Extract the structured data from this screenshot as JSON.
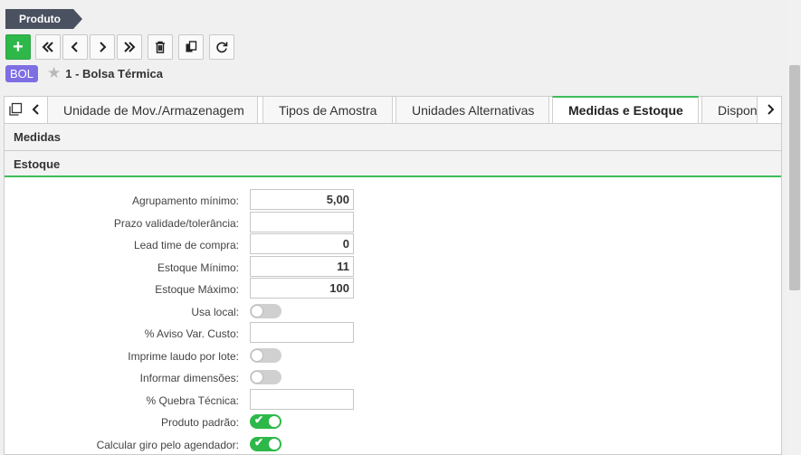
{
  "breadcrumb": {
    "label": "Produto"
  },
  "toolbar": {
    "add_label": "+"
  },
  "record": {
    "badge": "BOL",
    "title": "1 - Bolsa Térmica"
  },
  "tabs": [
    {
      "label": "Unidade de Mov./Armazenagem"
    },
    {
      "label": "Tipos de Amostra"
    },
    {
      "label": "Unidades Alternativas"
    },
    {
      "label": "Medidas e Estoque"
    },
    {
      "label": "Dispon"
    }
  ],
  "sections": {
    "medidas": "Medidas",
    "estoque": "Estoque"
  },
  "fields": [
    {
      "label": "Agrupamento mínimo:",
      "type": "input",
      "value": "5,00"
    },
    {
      "label": "Prazo validade/tolerância:",
      "type": "input",
      "value": ""
    },
    {
      "label": "Lead time de compra:",
      "type": "input",
      "value": "0"
    },
    {
      "label": "Estoque Mínimo:",
      "type": "input",
      "value": "11"
    },
    {
      "label": "Estoque Máximo:",
      "type": "input",
      "value": "100"
    },
    {
      "label": "Usa local:",
      "type": "toggle",
      "checked": false
    },
    {
      "label": "% Aviso Var. Custo:",
      "type": "input",
      "value": ""
    },
    {
      "label": "Imprime laudo por lote:",
      "type": "toggle",
      "checked": false
    },
    {
      "label": "Informar dimensões:",
      "type": "toggle",
      "checked": false
    },
    {
      "label": "% Quebra Técnica:",
      "type": "input",
      "value": ""
    },
    {
      "label": "Produto padrão:",
      "type": "toggle",
      "checked": true
    },
    {
      "label": "Calcular giro pelo agendador:",
      "type": "toggle",
      "checked": true
    }
  ],
  "colors": {
    "accent": "#2fb84a",
    "badge": "#7e6ee4",
    "breadcrumb": "#4a5160"
  }
}
